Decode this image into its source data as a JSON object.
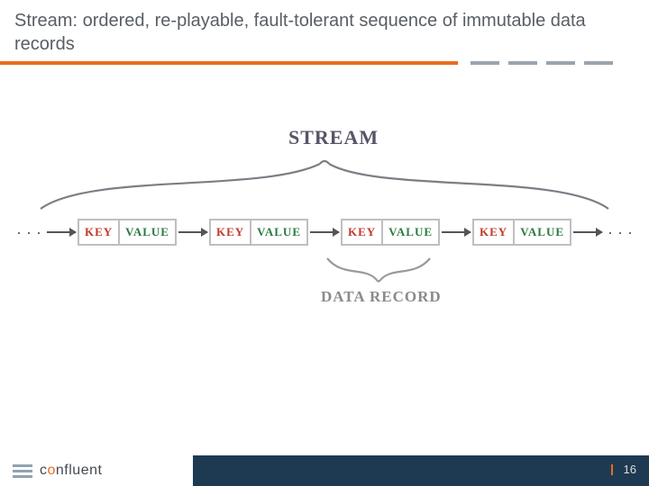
{
  "title": "Stream: ordered, re-playable, fault-tolerant sequence of immutable data records",
  "diagram": {
    "stream_label": "STREAM",
    "record_label": "DATA RECORD",
    "ellipsis": "· · ·",
    "records": [
      {
        "key": "KEY",
        "value": "VALUE"
      },
      {
        "key": "KEY",
        "value": "VALUE"
      },
      {
        "key": "KEY",
        "value": "VALUE"
      },
      {
        "key": "KEY",
        "value": "VALUE"
      }
    ]
  },
  "footer": {
    "brand_pre": "c",
    "brand_accent": "o",
    "brand_post": "nfluent",
    "page": "16"
  }
}
